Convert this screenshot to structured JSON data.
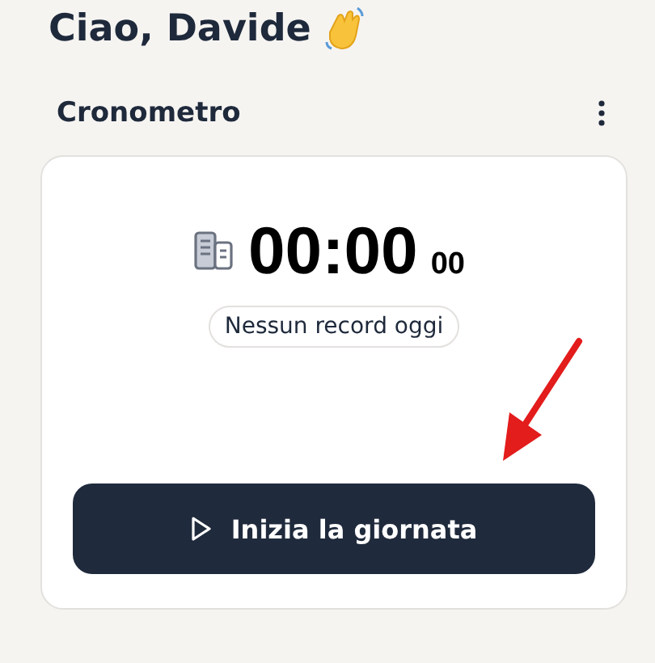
{
  "greeting": "Ciao, Davide",
  "section": {
    "title": "Cronometro"
  },
  "timer": {
    "time": "00:00",
    "seconds": "00",
    "status": "Nessun record oggi"
  },
  "start_button": {
    "label": "Inizia la giornata"
  }
}
